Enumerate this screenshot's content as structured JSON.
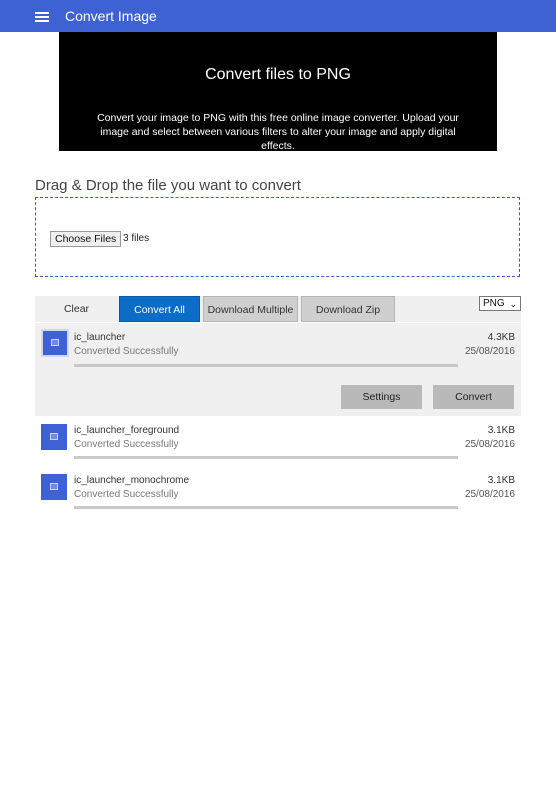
{
  "appbar": {
    "title": "Convert Image",
    "menu_icon": "hamburger-icon"
  },
  "hero": {
    "title": "Convert files to PNG",
    "description": "Convert your image to PNG with this free online image converter. Upload your image and select between various filters to alter your image and apply digital effects."
  },
  "dropzone": {
    "title": "Drag & Drop the file you want to convert",
    "choose_label": "Choose Files",
    "file_count": "3 files"
  },
  "toolbar": {
    "clear": "Clear",
    "convert_all": "Convert All",
    "download_multiple": "Download Multiple",
    "download_zip": "Download Zip"
  },
  "format": {
    "selected": "PNG"
  },
  "files": [
    {
      "name": "ic_launcher",
      "status": "Converted Successfully",
      "size": "4.3KB",
      "date": "25/08/2016",
      "progress": 1.0,
      "settings": "Settings",
      "convert": "Convert"
    },
    {
      "name": "ic_launcher_foreground",
      "status": "Converted Successfully",
      "size": "3.1KB",
      "date": "25/08/2016",
      "progress": 1.0
    },
    {
      "name": "ic_launcher_monochrome",
      "status": "Converted Successfully",
      "size": "3.1KB",
      "date": "25/08/2016",
      "progress": 1.0
    }
  ],
  "colors": {
    "accent": "#3e62d4",
    "primary_button": "#0b6dc8"
  }
}
